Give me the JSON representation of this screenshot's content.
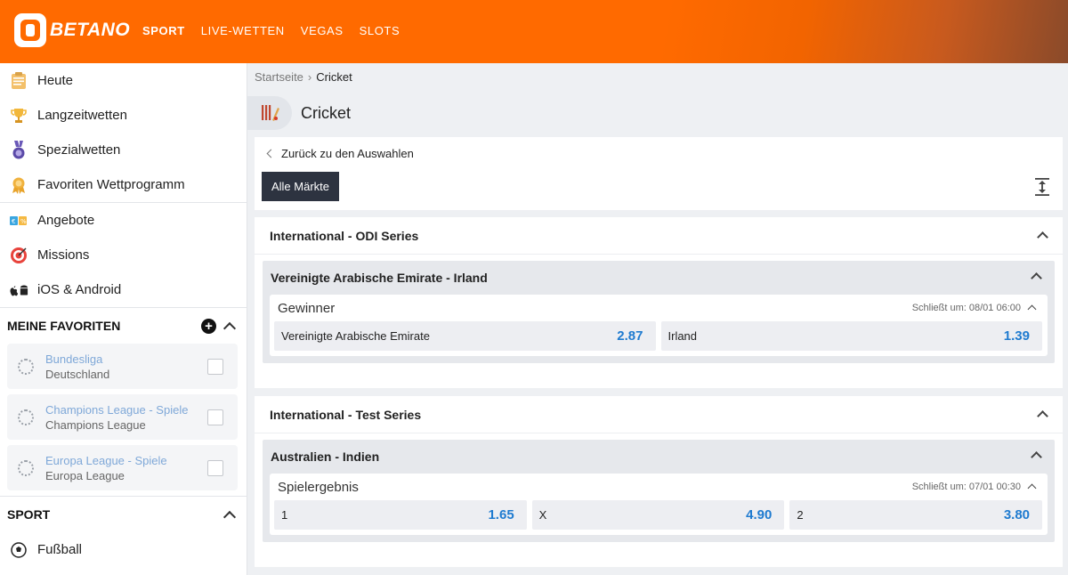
{
  "brand": {
    "name": "BETANO"
  },
  "topnav": [
    "SPORT",
    "LIVE-WETTEN",
    "VEGAS",
    "SLOTS"
  ],
  "sidebar": {
    "items": [
      {
        "label": "Heute",
        "icon": "calendar-icon"
      },
      {
        "label": "Langzeitwetten",
        "icon": "trophy-icon"
      },
      {
        "label": "Spezialwetten",
        "icon": "medal-icon"
      },
      {
        "label": "Favoriten Wettprogramm",
        "icon": "ribbon-icon"
      },
      {
        "label": "Angebote",
        "icon": "offers-icon"
      },
      {
        "label": "Missions",
        "icon": "target-icon"
      },
      {
        "label": "iOS & Android",
        "icon": "apple-android-icon"
      }
    ],
    "favorites_title": "MEINE FAVORITEN",
    "favorites": [
      {
        "name": "Bundesliga",
        "sub": "Deutschland"
      },
      {
        "name": "Champions League - Spiele",
        "sub": "Champions League"
      },
      {
        "name": "Europa League - Spiele",
        "sub": "Europa League"
      }
    ],
    "sport_title": "SPORT",
    "sport_items": [
      {
        "label": "Fußball",
        "icon": "soccer-ball-icon"
      }
    ]
  },
  "breadcrumb": {
    "home": "Startseite",
    "current": "Cricket"
  },
  "page_title": "Cricket",
  "back_label": "Zurück zu den Auswahlen",
  "all_markets_label": "Alle Märkte",
  "leagues": [
    {
      "title": "International - ODI Series",
      "event": "Vereinigte Arabische Emirate - Irland",
      "market": "Gewinner",
      "closes": "Schließt um: 08/01 06:00",
      "odds": [
        {
          "label": "Vereinigte Arabische Emirate",
          "value": "2.87"
        },
        {
          "label": "Irland",
          "value": "1.39"
        }
      ]
    },
    {
      "title": "International - Test Series",
      "event": "Australien - Indien",
      "market": "Spielergebnis",
      "closes": "Schließt um: 07/01 00:30",
      "odds": [
        {
          "label": "1",
          "value": "1.65"
        },
        {
          "label": "X",
          "value": "4.90"
        },
        {
          "label": "2",
          "value": "3.80"
        }
      ]
    }
  ],
  "colors": {
    "brand": "#ff6a00",
    "odds": "#1f7bd0",
    "button_dark": "#2d3340"
  }
}
